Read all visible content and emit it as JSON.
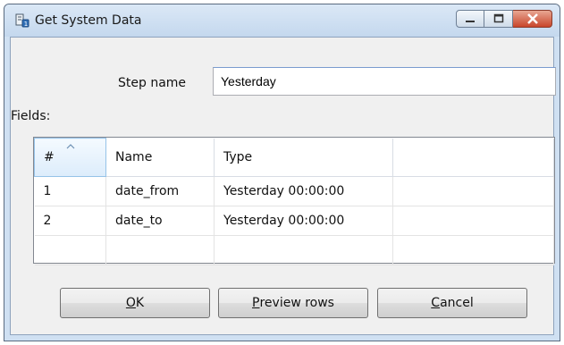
{
  "window": {
    "title": "Get System Data"
  },
  "form": {
    "step_name_label": "Step name",
    "step_name_value": "Yesterday",
    "fields_label": "Fields:"
  },
  "table": {
    "columns": [
      "#",
      "Name",
      "Type",
      ""
    ],
    "rows": [
      [
        "1",
        "date_from",
        "Yesterday 00:00:00",
        ""
      ],
      [
        "2",
        "date_to",
        "Yesterday 00:00:00",
        ""
      ],
      [
        "",
        "",
        "",
        ""
      ]
    ]
  },
  "buttons": {
    "ok": {
      "mnemonic": "O",
      "rest": "K"
    },
    "preview": {
      "mnemonic": "P",
      "rest": "review rows"
    },
    "cancel": {
      "mnemonic": "C",
      "rest": "ancel"
    }
  },
  "colors": {
    "title_bar": "#c4d8ee",
    "close_button": "#c9462c",
    "dialog_bg": "#f0f0f0"
  },
  "icons": [
    "app-icon",
    "minimize-icon",
    "maximize-icon",
    "close-icon",
    "sort-asc-icon"
  ]
}
